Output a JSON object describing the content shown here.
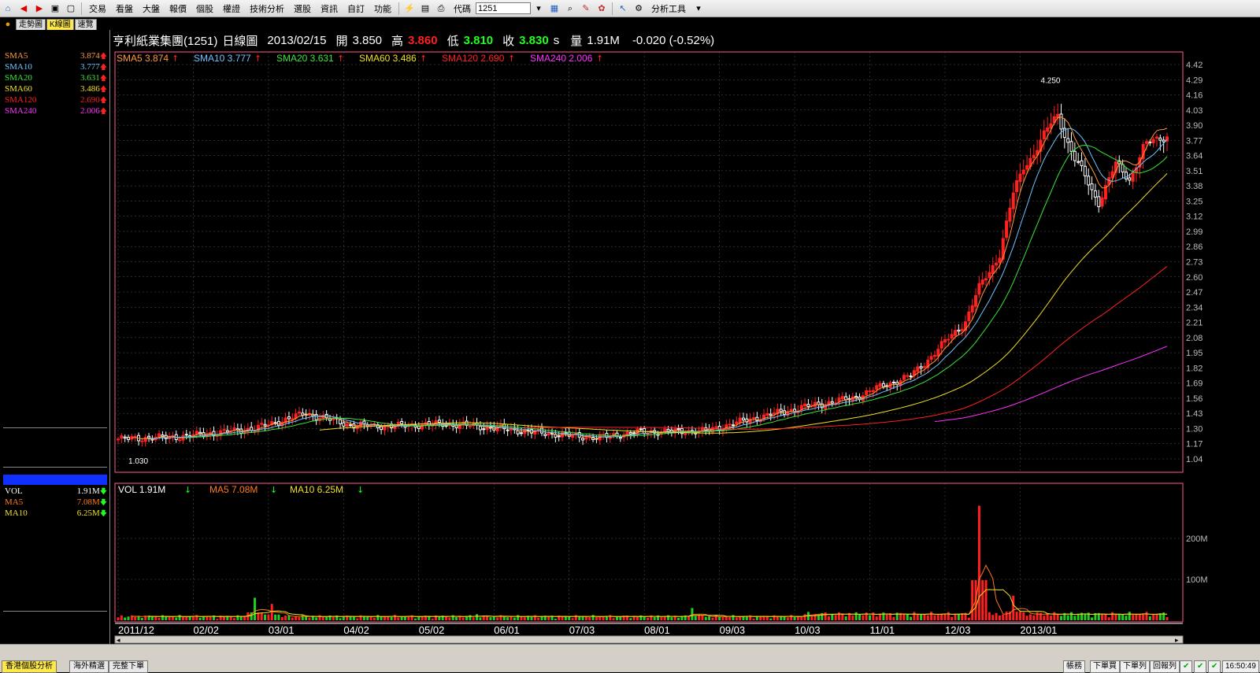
{
  "toolbar": {
    "menus": [
      "交易",
      "看盤",
      "大盤",
      "報價",
      "個股",
      "權證",
      "技術分析",
      "選股",
      "資訊",
      "自訂",
      "功能"
    ],
    "code_label": "代碼",
    "code_value": "1251",
    "tool_label": "分析工具"
  },
  "tabs": [
    "走勢圖",
    "K線圖",
    "速覽"
  ],
  "header": {
    "name": "亨利紙業集團(1251)",
    "period": "日線圖",
    "date": "2013/02/15",
    "open_label": "開",
    "open": "3.850",
    "high_label": "高",
    "high": "3.860",
    "low_label": "低",
    "low": "3.810",
    "close_label": "收",
    "close": "3.830",
    "close_suffix": "s",
    "volume_label": "量",
    "volume": "1.91M",
    "change": "-0.020 (-0.52%)"
  },
  "sma_legend": [
    {
      "label": "SMA5",
      "value": "3.874",
      "color": "#ff9a3c"
    },
    {
      "label": "SMA10",
      "value": "3.777",
      "color": "#6fc3ff"
    },
    {
      "label": "SMA20",
      "value": "3.631",
      "color": "#39e639"
    },
    {
      "label": "SMA60",
      "value": "3.486",
      "color": "#f0e020"
    },
    {
      "label": "SMA120",
      "value": "2.690",
      "color": "#ff2020"
    },
    {
      "label": "SMA240",
      "value": "2.006",
      "color": "#ff30ff"
    }
  ],
  "vol_legend": {
    "vol_label": "VOL",
    "vol_value": "1.91M",
    "ma5_label": "MA5",
    "ma5_value": "7.08M",
    "ma10_label": "MA10",
    "ma10_value": "6.25M"
  },
  "statusbar": {
    "tabs": [
      "香港個股分析",
      "海外精選",
      "完整下單"
    ],
    "buttons": [
      "帳務",
      "下單買",
      "下單列",
      "回報列"
    ],
    "time": "16:50:49"
  },
  "colors": {
    "up": "#ff2020",
    "down": "#ffffff",
    "grid": "#555555",
    "axis": "#bbbbbb",
    "frame": "#ff5a8a"
  },
  "chart_data": [
    {
      "type": "candlestick",
      "title": "亨利紙業集團(1251) 日線圖",
      "x_tick_labels": [
        "2011/12",
        "02/02",
        "03/01",
        "04/02",
        "05/02",
        "06/01",
        "07/03",
        "08/01",
        "09/03",
        "10/03",
        "11/01",
        "12/03",
        "2013/01"
      ],
      "y_tick_labels": [
        "4.42",
        "4.29",
        "4.16",
        "4.03",
        "3.90",
        "3.77",
        "3.64",
        "3.51",
        "3.38",
        "3.25",
        "3.12",
        "2.99",
        "2.86",
        "2.73",
        "2.60",
        "2.47",
        "2.34",
        "2.21",
        "2.08",
        "1.95",
        "1.82",
        "1.69",
        "1.56",
        "1.43",
        "1.30",
        "1.17",
        "1.04"
      ],
      "ylim": [
        1.04,
        4.42
      ],
      "annotations": [
        {
          "label": "1.030",
          "note": "period low"
        },
        {
          "label": "4.250",
          "note": "period high"
        }
      ],
      "sma_last": {
        "SMA5": 3.874,
        "SMA10": 3.777,
        "SMA20": 3.631,
        "SMA60": 3.486,
        "SMA120": 2.69,
        "SMA240": 2.006
      },
      "close_anchors": {
        "x": [
          0,
          18,
          40,
          55,
          68,
          80,
          95,
          105,
          125,
          140,
          152,
          172,
          185,
          200,
          215,
          225,
          232,
          238,
          248,
          252,
          258,
          262,
          265,
          270,
          275,
          280,
          287,
          292,
          296,
          300,
          307
        ],
        "y": [
          1.21,
          1.23,
          1.3,
          1.43,
          1.33,
          1.32,
          1.34,
          1.32,
          1.26,
          1.22,
          1.27,
          1.28,
          1.38,
          1.48,
          1.56,
          1.68,
          1.75,
          1.92,
          2.22,
          2.5,
          2.8,
          3.3,
          3.55,
          3.75,
          4.0,
          3.6,
          3.25,
          3.55,
          3.45,
          3.7,
          3.83
        ]
      }
    },
    {
      "type": "bar",
      "title": "VOL",
      "y_tick_labels": [
        "200M",
        "100M"
      ],
      "ylim": [
        0,
        300
      ],
      "ma_last": {
        "MA5": 7.08,
        "MA10": 6.25
      },
      "spikes": [
        {
          "x": 40,
          "value": 55
        },
        {
          "x": 45,
          "value": 40
        },
        {
          "x": 105,
          "value": 15
        },
        {
          "x": 168,
          "value": 30
        },
        {
          "x": 252,
          "value": 280
        },
        {
          "x": 262,
          "value": 60
        }
      ]
    }
  ]
}
